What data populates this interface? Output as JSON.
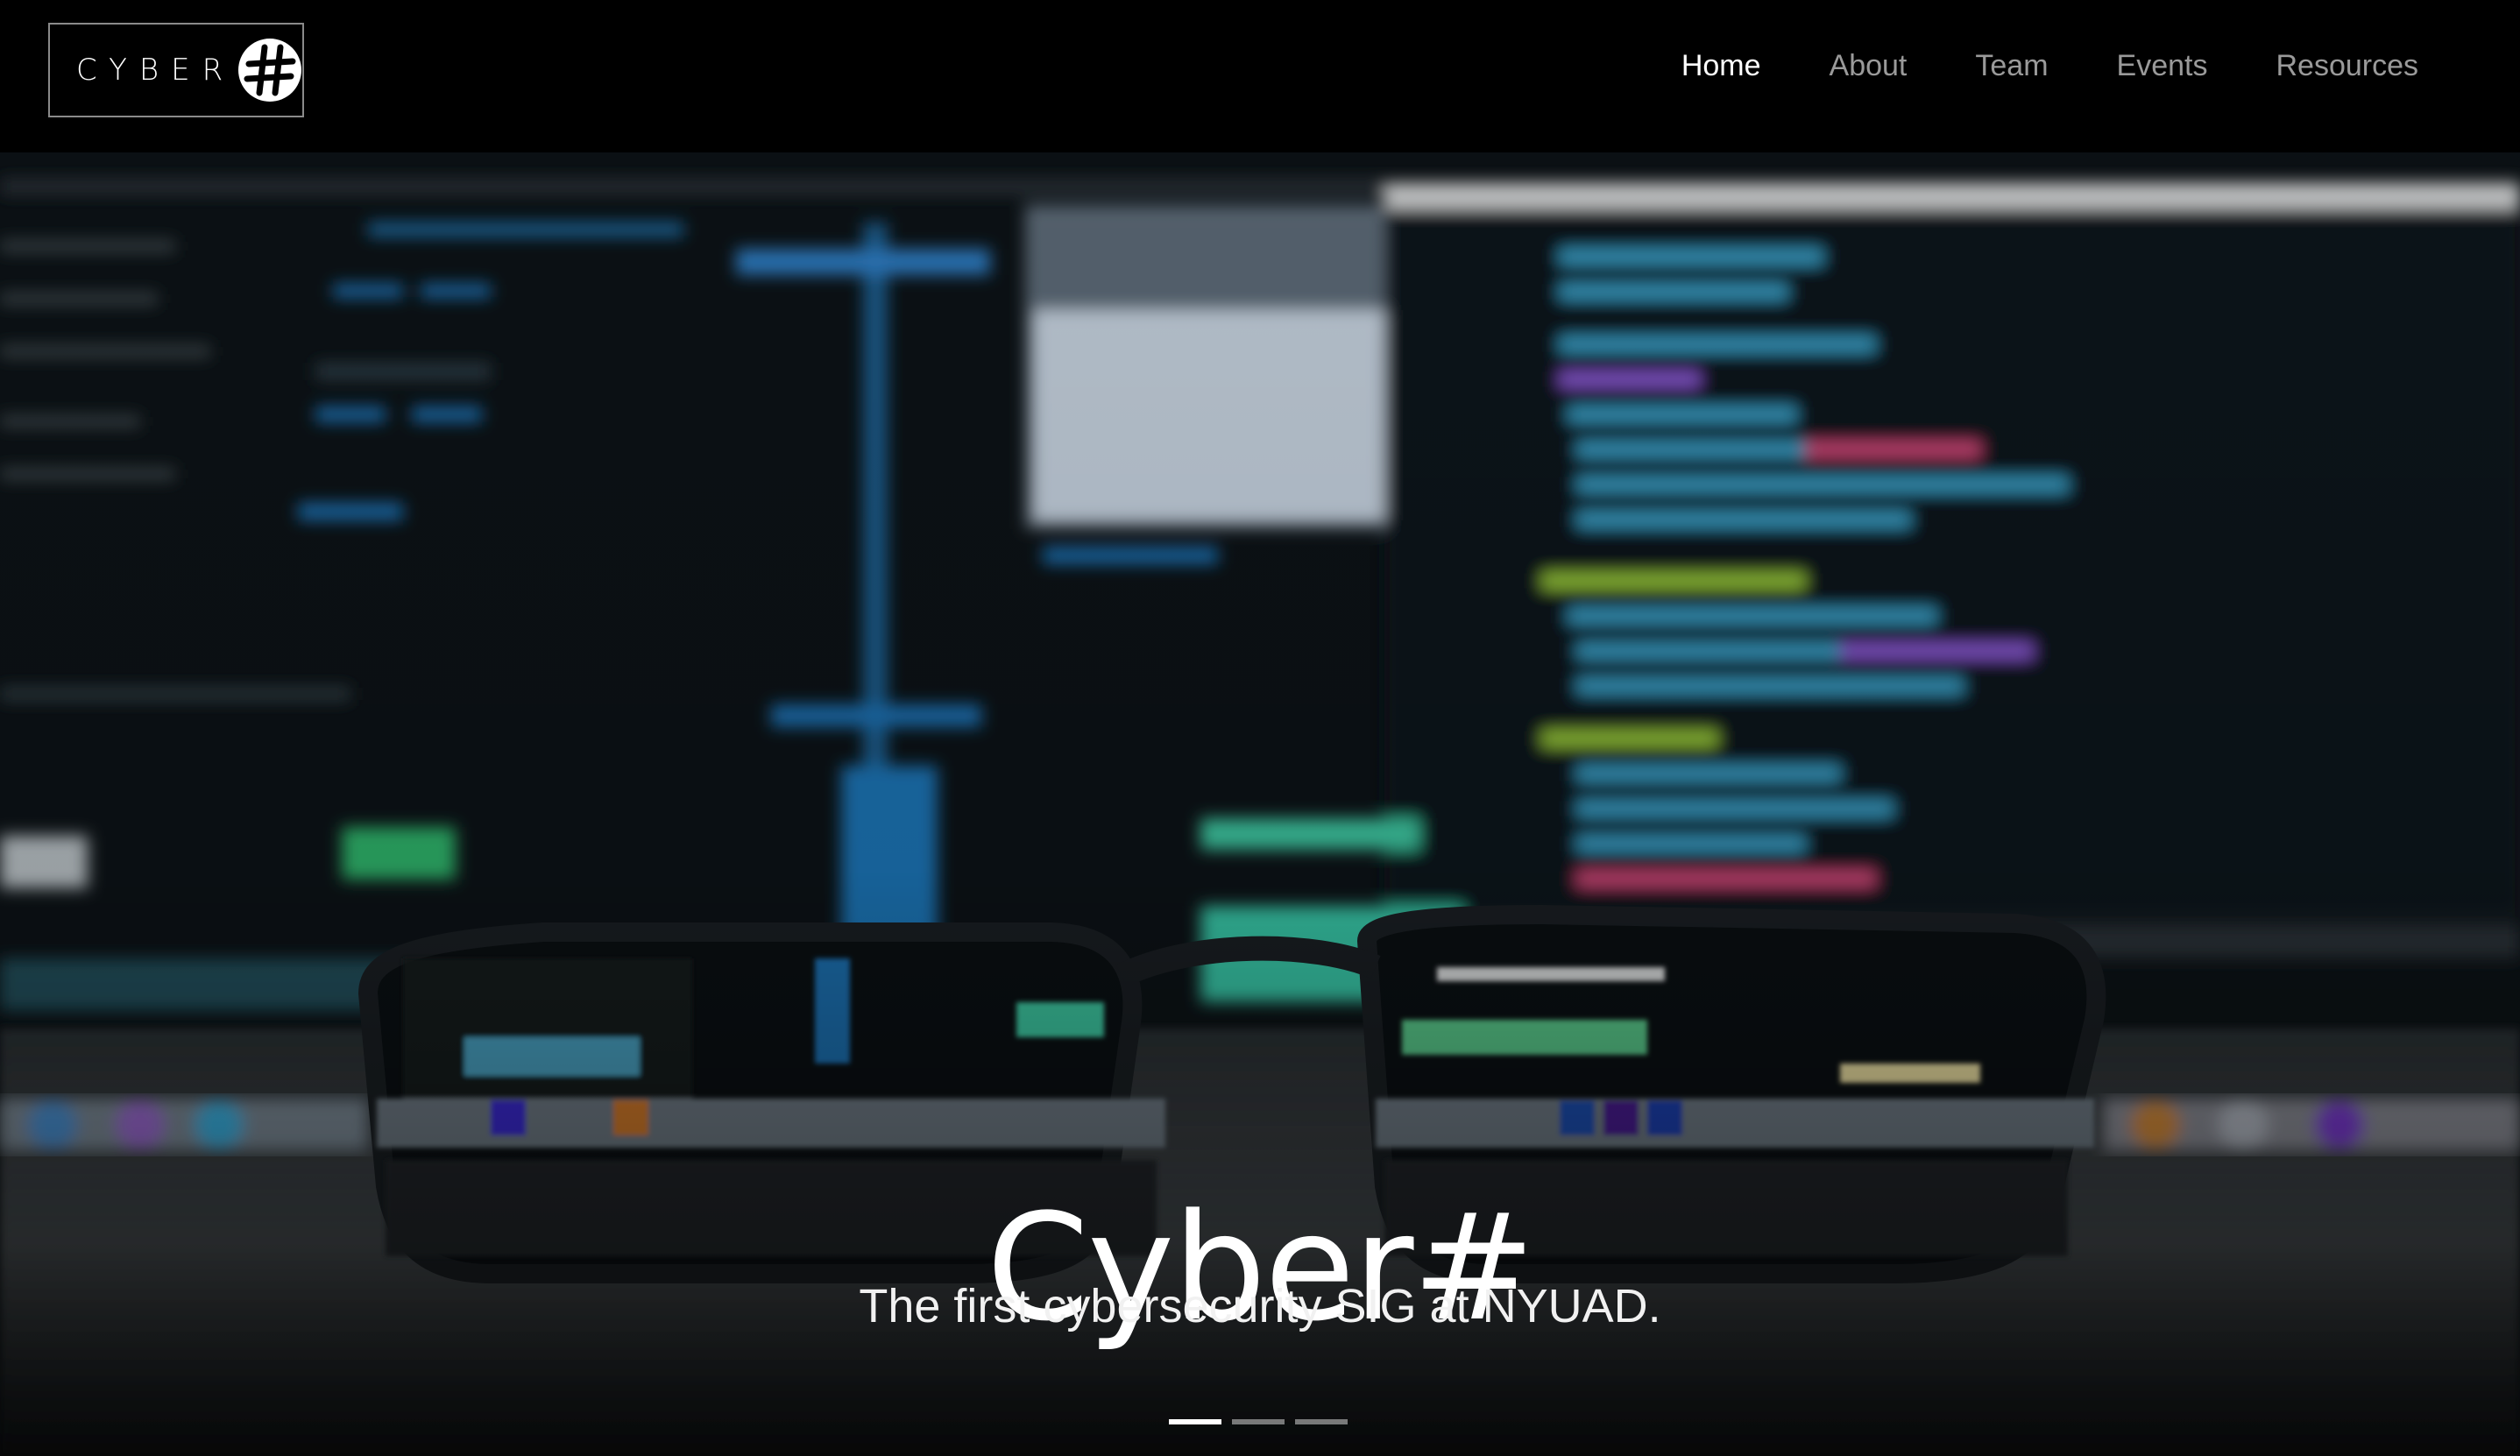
{
  "brand": {
    "logo_text": "CYBER",
    "logo_symbol": "#",
    "accent_color": "#ffffff"
  },
  "nav": {
    "items": [
      {
        "label": "Home",
        "active": true
      },
      {
        "label": "About",
        "active": false
      },
      {
        "label": "Team",
        "active": false
      },
      {
        "label": "Events",
        "active": false
      },
      {
        "label": "Resources",
        "active": false
      }
    ]
  },
  "hero": {
    "title": "Cyber#",
    "subtitle": "The first cybersecurity SIG at NYUAD.",
    "background_icon": "blurred-code-monitor-with-glasses-image",
    "slides": [
      {
        "active": true
      },
      {
        "active": false
      },
      {
        "active": false
      }
    ]
  }
}
